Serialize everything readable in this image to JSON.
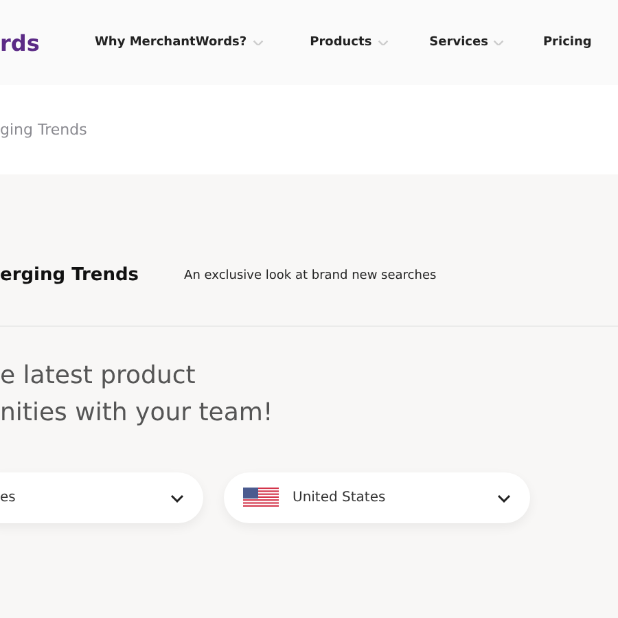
{
  "header": {
    "logo": "rds",
    "nav": [
      {
        "label": "Why MerchantWords?",
        "dropdown": true
      },
      {
        "label": "Products",
        "dropdown": true
      },
      {
        "label": "Services",
        "dropdown": true
      },
      {
        "label": "Pricing",
        "dropdown": false
      }
    ]
  },
  "breadcrumb": "ging Trends",
  "section": {
    "title": "erging Trends",
    "subtitle": "An exclusive look at brand new searches"
  },
  "heading": [
    "e latest product",
    "nities with your team!"
  ],
  "selects": [
    {
      "value": "es",
      "flag": false
    },
    {
      "value": "United States",
      "flag": true
    }
  ]
}
